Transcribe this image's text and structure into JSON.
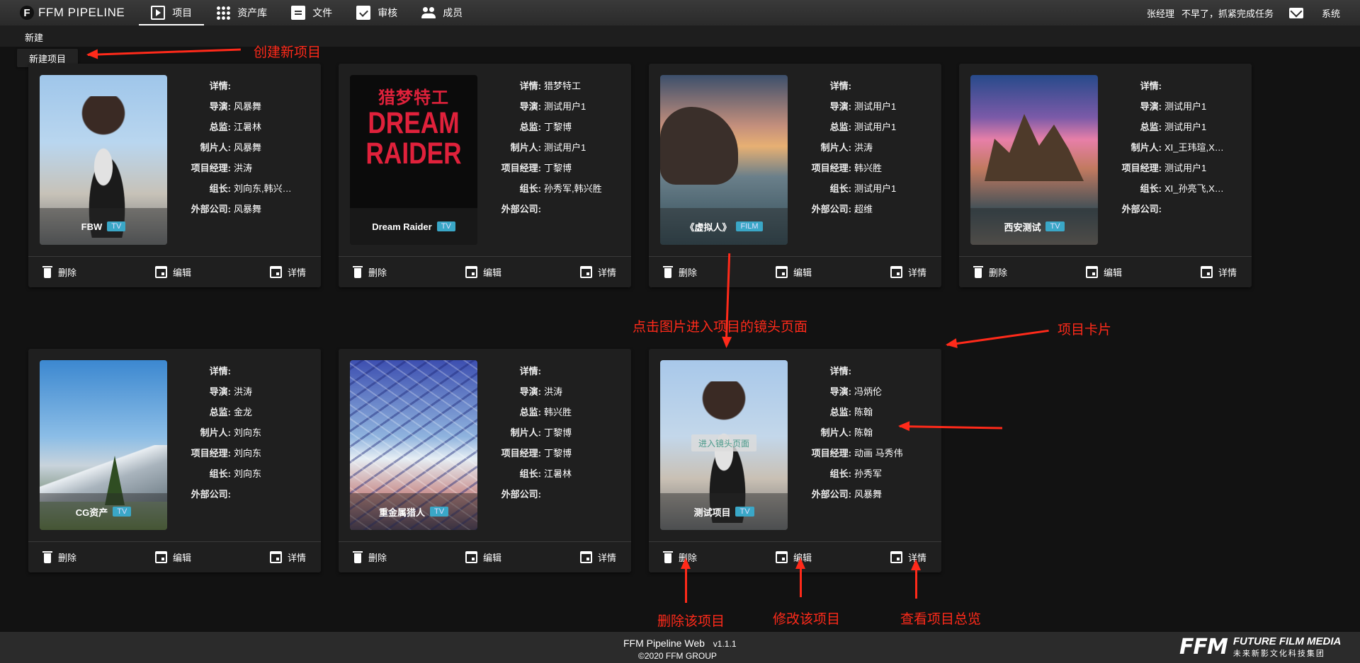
{
  "header": {
    "logo_letter": "F",
    "app_title": "FFM PIPELINE",
    "nav": [
      {
        "label": "项目",
        "icon": "project-icon",
        "active": true
      },
      {
        "label": "资产库",
        "icon": "grid-icon"
      },
      {
        "label": "文件",
        "icon": "clipboard-icon"
      },
      {
        "label": "审核",
        "icon": "check-icon"
      },
      {
        "label": "成员",
        "icon": "people-icon"
      }
    ],
    "user": "张经理",
    "greeting": "不早了，抓紧完成任务",
    "mail_icon": "mail-icon",
    "system": "系统"
  },
  "subbar": {
    "new_label": "新建",
    "new_project_button": "新建项目"
  },
  "field_labels": {
    "detail": "详情:",
    "director": "导演:",
    "supervisor": "总监:",
    "producer": "制片人:",
    "pm": "项目经理:",
    "lead": "组长:",
    "external": "外部公司:"
  },
  "action_labels": {
    "delete": "删除",
    "edit": "编辑",
    "detail": "详情"
  },
  "projects": [
    {
      "name": "FBW",
      "tag": "TV",
      "detail": "",
      "director": "风暴舞",
      "supervisor": "江暑林",
      "producer": "风暴舞",
      "pm": "洪涛",
      "lead": "刘向东,韩兴…",
      "external": "风暴舞"
    },
    {
      "name": "Dream Raider",
      "tag": "TV",
      "poster_cn": "猎梦特工",
      "poster_en": "DREAM RAIDER",
      "detail": "猎梦特工",
      "director": "测试用户1",
      "supervisor": "丁黎博",
      "producer": "测试用户1",
      "pm": "丁黎博",
      "lead": "孙秀军,韩兴胜",
      "external": ""
    },
    {
      "name": "《虚拟人》",
      "tag": "FILM",
      "detail": "",
      "director": "测试用户1",
      "supervisor": "测试用户1",
      "producer": "洪涛",
      "pm": "韩兴胜",
      "lead": "测试用户1",
      "external": "超维"
    },
    {
      "name": "西安测试",
      "tag": "TV",
      "detail": "",
      "director": "测试用户1",
      "supervisor": "测试用户1",
      "producer": "XI_王玮瑄,X…",
      "pm": "测试用户1",
      "lead": "XI_孙亮飞,X…",
      "external": ""
    },
    {
      "name": "CG资产",
      "tag": "TV",
      "detail": "",
      "director": "洪涛",
      "supervisor": "金龙",
      "producer": "刘向东",
      "pm": "刘向东",
      "lead": "刘向东",
      "external": ""
    },
    {
      "name": "重金属猎人",
      "tag": "TV",
      "detail": "",
      "director": "洪涛",
      "supervisor": "韩兴胜",
      "producer": "丁黎博",
      "pm": "丁黎博",
      "lead": "江暑林",
      "external": ""
    },
    {
      "name": "测试项目",
      "tag": "TV",
      "enter_button": "进入镜头页面",
      "detail": "",
      "director": "冯炳伦",
      "supervisor": "陈翰",
      "producer": "陈翰",
      "pm": "动画 马秀伟",
      "lead": "孙秀军",
      "external": "风暴舞"
    }
  ],
  "annotations": {
    "create": "创建新项目",
    "click_image": "点击图片进入项目的镜头页面",
    "card": "项目卡片",
    "delete": "删除该项目",
    "edit": "修改该项目",
    "overview": "查看项目总览"
  },
  "footer": {
    "title": "FFM Pipeline Web",
    "version": "v1.1.1",
    "copyright": "©2020 FFM GROUP",
    "brand_mark": "FFM",
    "brand_en": "FUTURE FILM MEDIA",
    "brand_cn": "未来新影文化科技集团"
  },
  "colors": {
    "accent_tag": "#3aa7c7",
    "annotation": "#ff2a1a",
    "background": "#121212",
    "card": "#1f1f1f"
  }
}
